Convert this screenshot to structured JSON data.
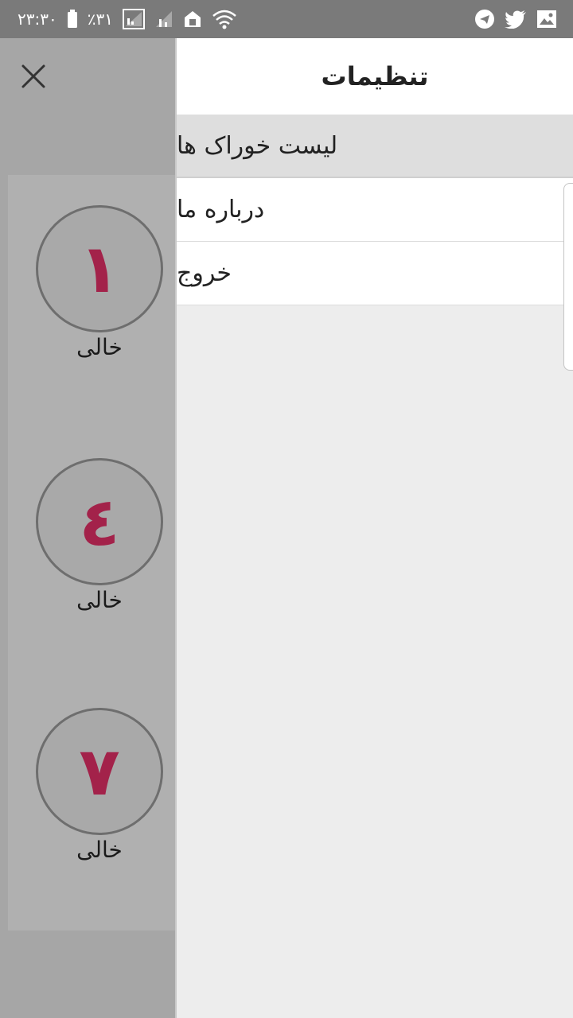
{
  "status_bar": {
    "time": "۲۳:۳۰",
    "battery": "٪۳۱",
    "icons": [
      "battery-icon",
      "signal-icon",
      "signal-icon-2",
      "home-data-icon",
      "wifi-icon",
      "telegram-icon",
      "twitter-icon",
      "gallery-icon"
    ]
  },
  "drawer": {
    "title": "تنظیمات",
    "menu_items": [
      {
        "label": "لیست خوراک ها",
        "active": true
      },
      {
        "label": "درباره ما",
        "active": false
      },
      {
        "label": "خروج",
        "active": false
      }
    ]
  },
  "tables": [
    {
      "number": "١",
      "status": "خالی"
    },
    {
      "number": "٤",
      "status": "خالی"
    },
    {
      "number": "٧",
      "status": "خالی"
    }
  ],
  "colors": {
    "accent": "#a3224a",
    "overlay": "#a6a6a6",
    "status_bar": "#7a7a7a"
  }
}
